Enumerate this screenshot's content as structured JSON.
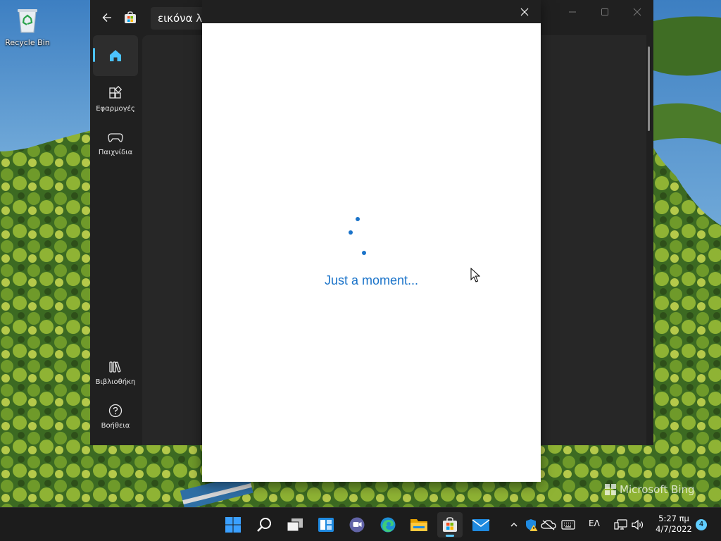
{
  "desktop": {
    "recycle_bin_label": "Recycle Bin",
    "watermark": "Microsoft Bing"
  },
  "store_window": {
    "search_value": "εικόνα λ",
    "nav": [
      {
        "label": "",
        "icon": "home-icon",
        "active": true
      },
      {
        "label": "Εφαρμογές",
        "icon": "apps-icon",
        "active": false
      },
      {
        "label": "Παιχνίδια",
        "icon": "gamepad-icon",
        "active": false
      },
      {
        "label": "Βιβλιοθήκη",
        "icon": "library-icon",
        "active": false
      },
      {
        "label": "Βοήθεια",
        "icon": "help-icon",
        "active": false
      }
    ]
  },
  "dialog": {
    "loading_text": "Just a moment..."
  },
  "taskbar": {
    "apps": [
      "start-icon",
      "search-icon",
      "task-view-icon",
      "widgets-icon",
      "teams-chat-icon",
      "edge-icon",
      "file-explorer-icon",
      "store-icon",
      "mail-icon"
    ],
    "active_app": "store-icon",
    "language": "ΕΛ",
    "time": "5:27 πμ",
    "date": "4/7/2022",
    "notification_count": "4"
  },
  "colors": {
    "accent": "#1a73c9",
    "taskbar_accent": "#60cdff",
    "store_bg": "#202020"
  }
}
